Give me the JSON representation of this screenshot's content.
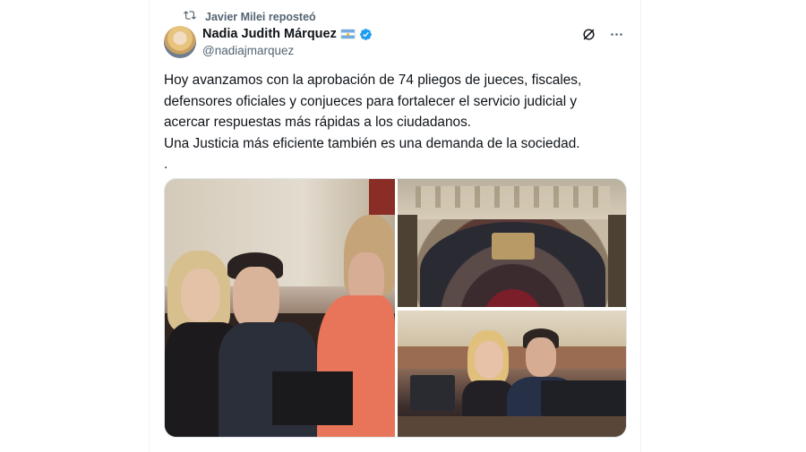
{
  "repost": {
    "label": "Javier Milei reposteó",
    "icon": "repost-icon"
  },
  "author": {
    "name": "Nadia Judith Márquez",
    "handle": "@nadiajmarquez",
    "flag": "argentina-flag-icon",
    "verified": true,
    "verified_color": "#1d9bf0"
  },
  "actions": {
    "grok_icon": "grok-icon",
    "more_icon": "more-options-icon"
  },
  "tweet": {
    "lines": [
      "Hoy avanzamos con la aprobación de 74 pliegos de jueces, fiscales,",
      "defensores oficiales y conjueces para fortalecer el servicio judicial y",
      "acercar respuestas más rápidas a los ciudadanos.",
      "Una Justicia más eficiente también es una demanda de la sociedad.",
      "."
    ]
  },
  "media": [
    {
      "name": "photo-senators-conversation"
    },
    {
      "name": "photo-senate-chamber-overview"
    },
    {
      "name": "photo-two-senators-seated"
    }
  ]
}
